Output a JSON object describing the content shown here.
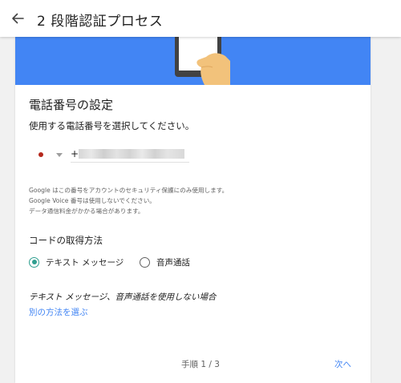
{
  "header": {
    "back_icon": "arrow-left-icon",
    "title": "2 段階認証プロセス"
  },
  "colors": {
    "banner": "#4285f4",
    "accent_teal": "#2e9e8f",
    "link": "#4285f4"
  },
  "phone_setup": {
    "title": "電話番号の設定",
    "instruction": "使用する電話番号を選択してください。",
    "phone_prefix": "+",
    "notes": [
      "Google はこの番号をアカウントのセキュリティ保護にのみ使用します。",
      "Google Voice 番号は使用しないでください。",
      "データ通信料金がかかる場合があります。"
    ]
  },
  "code_method": {
    "label": "コードの取得方法",
    "options": [
      {
        "label": "テキスト メッセージ",
        "selected": true
      },
      {
        "label": "音声通話",
        "selected": false
      }
    ]
  },
  "alternative": {
    "question": "テキスト メッセージ、音声通話を使用しない場合",
    "link": "別の方法を選ぶ"
  },
  "footer": {
    "step": "手順 1 / 3",
    "next": "次へ"
  }
}
